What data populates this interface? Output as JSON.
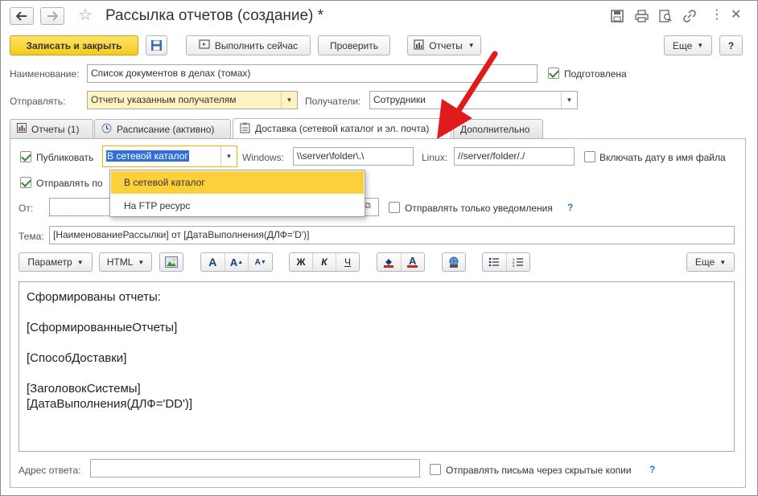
{
  "window": {
    "title": "Рассылка отчетов (создание) *"
  },
  "toolbar": {
    "save_close": "Записать и закрыть",
    "run_now": "Выполнить сейчас",
    "check": "Проверить",
    "reports": "Отчеты",
    "more": "Еще",
    "help": "?"
  },
  "form": {
    "name_label": "Наименование:",
    "name_value": "Список документов в делах (томах)",
    "prepared_label": "Подготовлена",
    "prepared_checked": true,
    "send_label": "Отправлять:",
    "send_value": "Отчеты указанным получателям",
    "recipients_label": "Получатели:",
    "recipients_value": "Сотрудники"
  },
  "tabs": [
    {
      "label": "Отчеты (1)",
      "icon": "report-icon"
    },
    {
      "label": "Расписание (активно)",
      "icon": "clock-icon"
    },
    {
      "label": "Доставка (сетевой каталог и эл. почта)",
      "icon": "delivery-icon",
      "active": true
    },
    {
      "label": "Дополнительно"
    }
  ],
  "delivery": {
    "publish_label": "Публиковать",
    "publish_checked": true,
    "publish_mode": "В сетевой каталог",
    "windows_label": "Windows:",
    "windows_value": "\\\\server\\folder\\.\\",
    "linux_label": "Linux:",
    "linux_value": "//server/folder/./",
    "include_date_label": "Включать дату в имя файла",
    "send_by_label": "Отправлять по",
    "from_label": "От:",
    "notify_only_label": "Отправлять только уведомления",
    "subject_label": "Тема:",
    "subject_value": "[НаименованиеРассылки] от [ДатаВыполнения(ДЛФ='D')]",
    "reply_label": "Адрес ответа:",
    "bcc_label": "Отправлять письма через скрытые копии",
    "help_mark": "?"
  },
  "popup": {
    "items": [
      "В сетевой каталог",
      "На FTP ресурс"
    ],
    "selected_index": 0
  },
  "editor_toolbar": {
    "param": "Параметр",
    "html": "HTML",
    "bold": "Ж",
    "italic": "К",
    "underline": "Ч",
    "more": "Еще"
  },
  "editor": {
    "lines": [
      "Сформированы отчеты:",
      "",
      "[СформированныеОтчеты]",
      "",
      "[СпособДоставки]",
      "",
      "[ЗаголовокСистемы]",
      "[ДатаВыполнения(ДЛФ='DD')]"
    ]
  },
  "colors": {
    "primary_button": "#f5cb1a",
    "selection": "#fbd03b",
    "required_field": "#fff3c2",
    "arrow": "#e11b1b",
    "check": "#2c8a2c"
  }
}
